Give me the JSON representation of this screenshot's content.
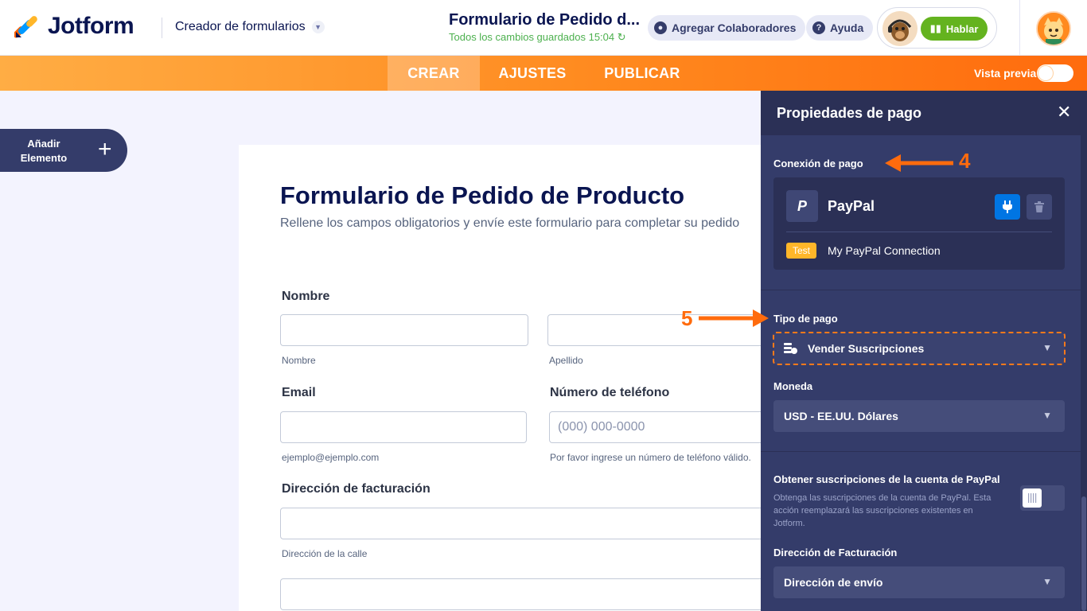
{
  "header": {
    "logo_text": "Jotform",
    "builder_label": "Creador de formularios",
    "form_title": "Formulario de Pedido d...",
    "saved_status": "Todos los cambios guardados 15:04",
    "add_collaborators": "Agregar Colaboradores",
    "help": "Ayuda",
    "talk": "Hablar"
  },
  "nav": {
    "tabs": [
      "CREAR",
      "AJUSTES",
      "PUBLICAR"
    ],
    "preview_label": "Vista previa"
  },
  "sidebar": {
    "add_element": "Añadir Elemento"
  },
  "form": {
    "title": "Formulario de Pedido de Producto",
    "subtitle": "Rellene los campos obligatorios y envíe este formulario para completar su pedido",
    "name_label": "Nombre",
    "first_name_help": "Nombre",
    "last_name_help": "Apellido",
    "email_label": "Email",
    "email_help": "ejemplo@ejemplo.com",
    "phone_label": "Número de teléfono",
    "phone_placeholder": "(000) 000-0000",
    "phone_help": "Por favor ingrese un número de teléfono válido.",
    "billing_label": "Dirección de facturación",
    "street_help": "Dirección de la calle"
  },
  "panel": {
    "title": "Propiedades de pago",
    "connection_label": "Conexión de pago",
    "gateway_name": "PayPal",
    "test_badge": "Test",
    "connection_name": "My PayPal Connection",
    "payment_type_label": "Tipo de pago",
    "payment_type_value": "Vender Suscripciones",
    "currency_label": "Moneda",
    "currency_value": "USD - EE.UU. Dólares",
    "fetch_title": "Obtener suscripciones de la cuenta de PayPal",
    "fetch_desc": "Obtenga las suscripciones de la cuenta de PayPal. Esta acción reemplazará las suscripciones existentes en Jotform.",
    "billing_address_label": "Dirección de Facturación",
    "billing_address_value": "Dirección de envío"
  },
  "annotations": {
    "step4": "4",
    "step5": "5"
  },
  "colors": {
    "accent_orange": "#ff6b0d",
    "panel_bg": "#343c6a",
    "paypal_blue": "#0075e3",
    "saved_green": "#4cb04e"
  }
}
